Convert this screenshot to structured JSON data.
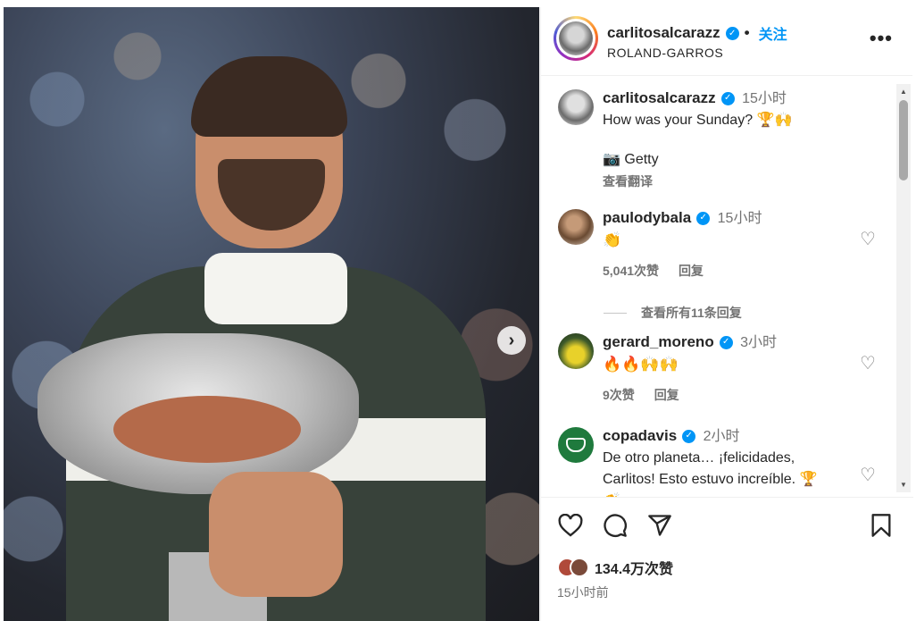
{
  "post": {
    "username": "carlitosalcarazz",
    "follow_label": "关注",
    "location": "ROLAND-GARROS",
    "more_label": "•••",
    "next_label": "›"
  },
  "caption": {
    "username": "carlitosalcarazz",
    "time": "15小时",
    "line1": "How was your Sunday? 🏆🙌",
    "line2": "📷 Getty",
    "translate_label": "查看翻译"
  },
  "comments": [
    {
      "username": "paulodybala",
      "time": "15小时",
      "text": "👏",
      "likes": "5,041次赞",
      "reply_label": "回复"
    },
    {
      "username": "gerard_moreno",
      "time": "3小时",
      "text": "🔥🔥🙌🙌",
      "likes": "9次赞",
      "reply_label": "回复"
    },
    {
      "username": "copadavis",
      "time": "2小时",
      "text_line1": "De otro planeta… ¡felicidades,",
      "text_line2": "Carlitos! Esto estuvo increíble. 🏆",
      "text_line3": "👏"
    }
  ],
  "view_replies_label": "查看所有11条回复",
  "footer": {
    "likes": "134.4万次赞",
    "posted": "15小时前"
  },
  "icons": [
    "verified-badge-icon",
    "heart-icon",
    "comment-icon",
    "share-icon",
    "bookmark-icon",
    "more-icon",
    "chevron-right-icon"
  ],
  "colors": {
    "accent": "#0095f6",
    "muted": "#737373",
    "text": "#262626"
  }
}
